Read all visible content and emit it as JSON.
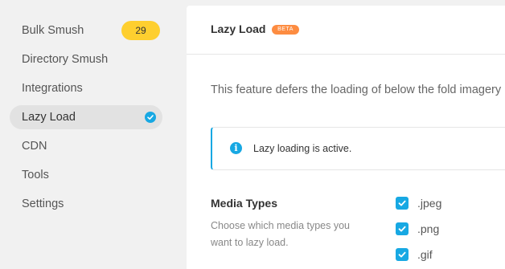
{
  "sidebar": {
    "items": [
      {
        "label": "Bulk Smush",
        "badge": "29"
      },
      {
        "label": "Directory Smush"
      },
      {
        "label": "Integrations"
      },
      {
        "label": "Lazy Load",
        "active": true
      },
      {
        "label": "CDN"
      },
      {
        "label": "Tools"
      },
      {
        "label": "Settings"
      }
    ]
  },
  "header": {
    "title": "Lazy Load",
    "tag": "BETA"
  },
  "main": {
    "description": "This feature defers the loading of below the fold imagery",
    "notice": {
      "icon": "info-icon",
      "text": "Lazy loading is active."
    },
    "media_types": {
      "title": "Media Types",
      "description": "Choose which media types you want to lazy load.",
      "options": [
        {
          "label": ".jpeg",
          "checked": true
        },
        {
          "label": ".png",
          "checked": true
        },
        {
          "label": ".gif",
          "checked": true
        }
      ]
    }
  },
  "colors": {
    "accent": "#17a8e3",
    "badge": "#fecf2f",
    "beta": "#fd8c41",
    "background": "#f1f1f1"
  }
}
